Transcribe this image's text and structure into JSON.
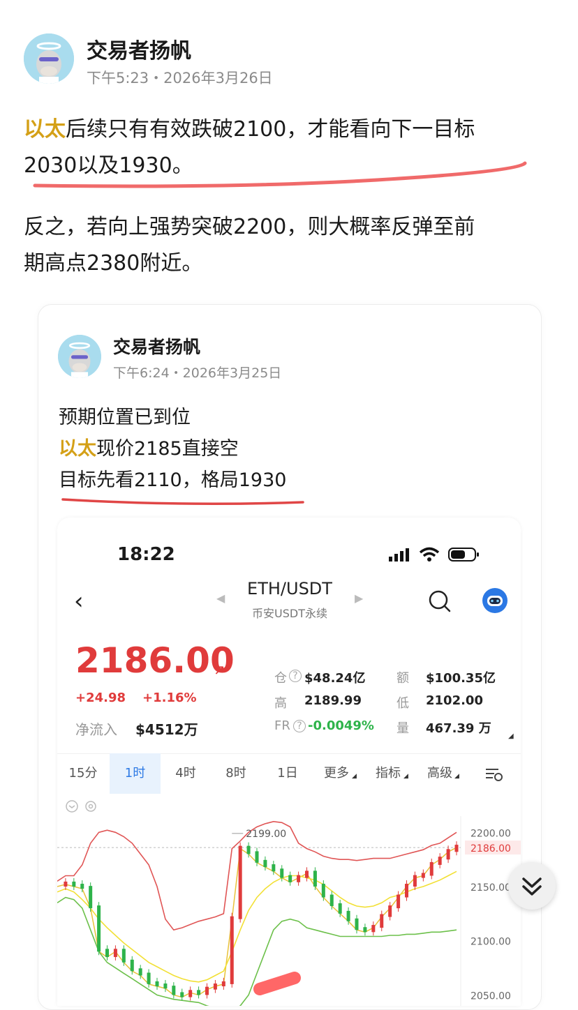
{
  "post": {
    "author": "交易者扬帆",
    "time": "下午5:23・2026年3月26日",
    "highlight": "以太",
    "para1_rest": "后续只有有效跌破2100，才能看向下一目标",
    "para1_line2": "2030以及1930。",
    "para2_line1": "反之，若向上强势突破2200，则大概率反弹至前",
    "para2_line2": "期高点2380附近。"
  },
  "quoted": {
    "author": "交易者扬帆",
    "time": "下午6:24・2026年3月25日",
    "line1": "预期位置已到位",
    "highlight": "以太",
    "line2_rest": "现价2185直接空",
    "line3": "目标先看2110，格局1930"
  },
  "trading": {
    "status_time": "18:22",
    "pair": "ETH/USDT",
    "exchange": "币安USDT永续",
    "price": "2186.00",
    "change_abs": "+24.98",
    "change_pct": "+1.16%",
    "netflow_label": "净流入",
    "netflow_value": "$4512万",
    "stats": {
      "oi_label": "仓",
      "oi_value": "$48.24亿",
      "amount_label": "额",
      "amount_value": "$100.35亿",
      "high_label": "高",
      "high_value": "2189.99",
      "low_label": "低",
      "low_value": "2102.00",
      "fr_label": "FR",
      "fr_value": "-0.0049%",
      "vol_label": "量",
      "vol_value": "467.39 万"
    },
    "tabs": [
      "15分",
      "1时",
      "4时",
      "8时",
      "1日",
      "更多",
      "指标",
      "高级"
    ],
    "active_tab": "1时",
    "colors": {
      "up": "#e03b3b",
      "down": "#2eb34a",
      "active_tab_bg": "#e8f2fd",
      "active_tab_text": "#2f7be5",
      "highlight": "#d4a017"
    }
  },
  "chart_data": {
    "type": "line",
    "title": "",
    "ylim": [
      2040,
      2215
    ],
    "ytick_labels": [
      "2200.00",
      "2150.00",
      "2100.00",
      "2050.00"
    ],
    "current_price_label": "2186.00",
    "annotation_high": "2199.00",
    "series": [
      {
        "values": [
          2150,
          2152,
          2150,
          2148,
          2130,
          2090,
          2085,
          2090,
          2080,
          2072,
          2068,
          2060,
          2058,
          2056,
          2050,
          2048,
          2052,
          2050,
          2055,
          2058,
          2060,
          2120,
          2185,
          2180,
          2172,
          2168,
          2164,
          2158,
          2154,
          2158,
          2162,
          2150,
          2140,
          2132,
          2125,
          2118,
          2110,
          2108,
          2112,
          2122,
          2130,
          2140,
          2150,
          2158,
          2160,
          2170,
          2175,
          2182,
          2186
        ]
      },
      {
        "values": [
          2155,
          2160,
          2160,
          2170,
          2190,
          2200,
          2202,
          2200,
          2196,
          2190,
          2180,
          2170,
          2150,
          2120,
          2110,
          2112,
          2115,
          2118,
          2120,
          2122,
          2125,
          2185,
          2192,
          2200,
          2205,
          2208,
          2210,
          2209,
          2205,
          2190,
          2185,
          2182,
          2178,
          2176,
          2175,
          2175,
          2174,
          2175,
          2176,
          2176,
          2176,
          2178,
          2180,
          2182,
          2184,
          2188,
          2190,
          2195,
          2200
        ]
      },
      {
        "values": [
          2145,
          2148,
          2145,
          2138,
          2130,
          2120,
          2112,
          2105,
          2098,
          2092,
          2086,
          2080,
          2076,
          2072,
          2068,
          2065,
          2063,
          2062,
          2064,
          2068,
          2072,
          2090,
          2110,
          2128,
          2140,
          2148,
          2154,
          2158,
          2160,
          2160,
          2158,
          2156,
          2152,
          2146,
          2140,
          2135,
          2132,
          2131,
          2132,
          2135,
          2140,
          2142,
          2145,
          2148,
          2150,
          2153,
          2156,
          2160,
          2164
        ]
      },
      {
        "values": [
          2135,
          2140,
          2138,
          2130,
          2110,
          2090,
          2080,
          2075,
          2070,
          2065,
          2060,
          2055,
          2050,
          2048,
          2046,
          2045,
          2044,
          2043,
          2040,
          2038,
          2037,
          2036,
          2040,
          2050,
          2070,
          2090,
          2110,
          2118,
          2120,
          2118,
          2112,
          2110,
          2108,
          2106,
          2104,
          2104,
          2104,
          2104,
          2104,
          2104,
          2105,
          2105,
          2106,
          2106,
          2107,
          2108,
          2108,
          2109,
          2110
        ]
      }
    ]
  }
}
